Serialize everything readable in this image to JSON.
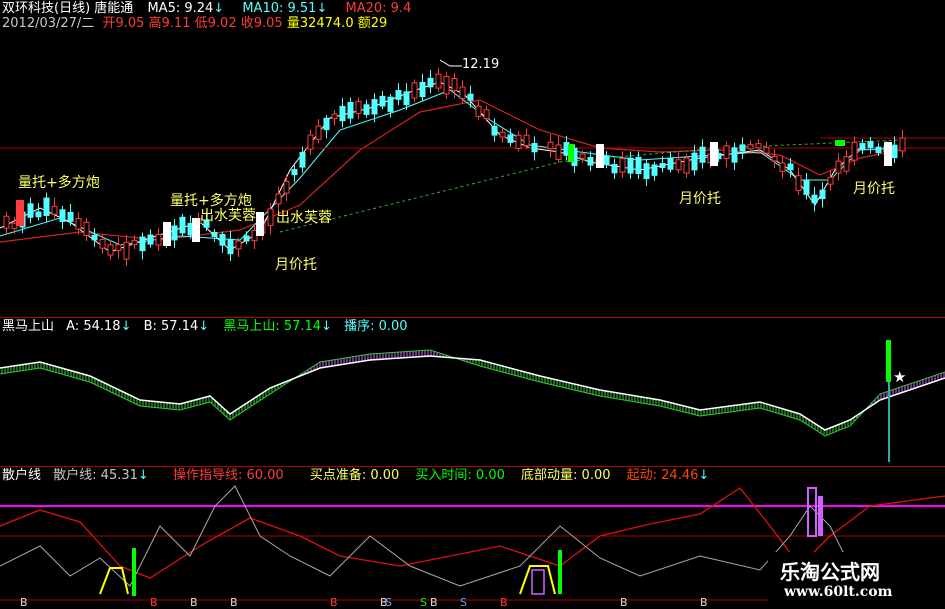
{
  "colors": {
    "up": "#ff3b3b",
    "down": "#55ffff",
    "ma5": "#ffffff",
    "ma10": "#55ffff",
    "ma20": "#d62020",
    "yellow": "#ffff00",
    "green": "#00ff00",
    "magenta": "#ff00ff",
    "purple": "#d060ff",
    "orange": "#ff4400"
  },
  "header": {
    "stock_name": "双环科技(日线)",
    "source": "唐能通",
    "ma5_label": "MA5: 9.24",
    "ma10_label": "MA10: 9.51",
    "ma20_label": "MA20: 9.4",
    "arrow": "↓",
    "date": "2012/03/27/二",
    "open": "开9.05",
    "high": "高9.11",
    "low": "低9.02",
    "close": "收9.05",
    "volume": "量32474.0",
    "amount": "额29"
  },
  "price_chart": {
    "peak_label": "12.19",
    "annotations": [
      "量托+多方炮",
      "量托+多方炮",
      "出水芙蓉",
      "出水芙蓉",
      "月价托",
      "月价托",
      "月价托"
    ]
  },
  "indicator1": {
    "title": "黑马上山",
    "a_label": "A: 54.18",
    "b_label": "B: 57.14",
    "c_label": "黑马上山: 57.14",
    "d_label": "播序: 0.00",
    "star": "★"
  },
  "indicator2": {
    "title": "散户线",
    "sh_label": "散户线: 45.31",
    "op_label": "操作指导线: 60.00",
    "buy_prep": "买点准备: 0.00",
    "buy_time": "买入时间: 0.00",
    "bottom": "底部动量: 0.00",
    "start": "起动: 24.46",
    "signal_letter": "B",
    "signal_s": "S"
  },
  "watermark": {
    "line1": "乐淘公式网",
    "line2": "www.60lt.com"
  }
}
